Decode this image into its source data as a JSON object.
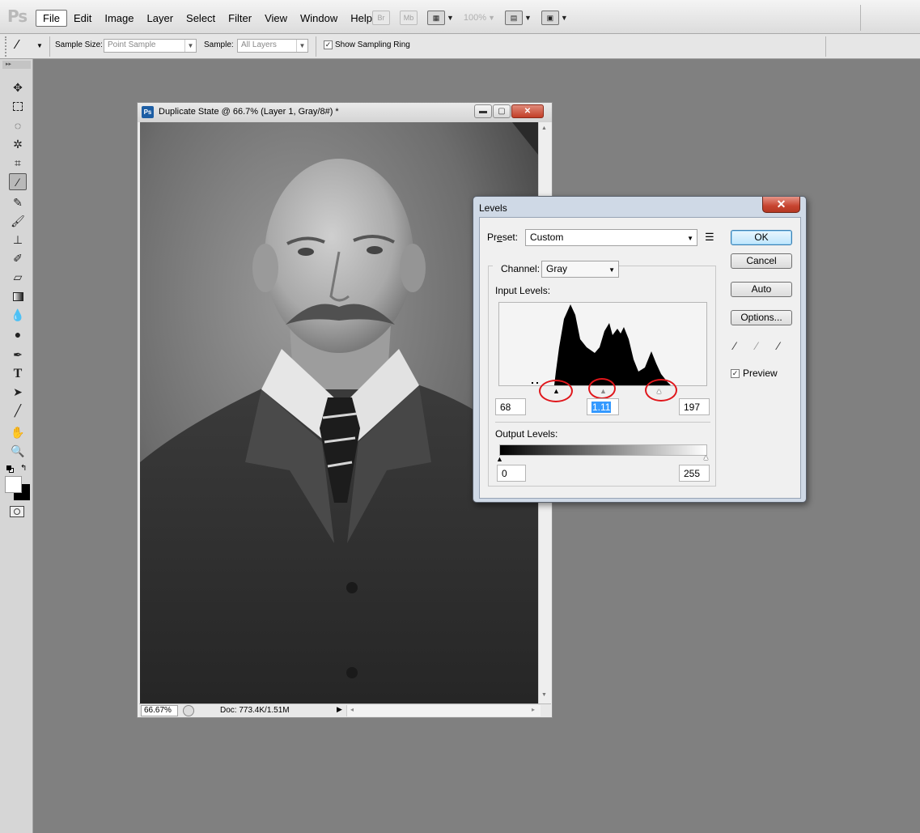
{
  "app": {
    "logo": "Ps",
    "menu": [
      "File",
      "Edit",
      "Image",
      "Layer",
      "Select",
      "Filter",
      "View",
      "Window",
      "Help"
    ],
    "menubar_icons": {
      "bridge": "Br",
      "mini_bridge": "Mb",
      "zoom": "100%"
    }
  },
  "options_bar": {
    "sample_size_label": "Sample Size:",
    "sample_size_value": "Point Sample",
    "sample_label": "Sample:",
    "sample_value": "All Layers",
    "show_ring_label": "Show Sampling Ring",
    "show_ring_checked": true
  },
  "toolbox": {
    "header": "▸▸",
    "tools": [
      "move-icon",
      "marquee-icon",
      "lasso-icon",
      "quick-select-icon",
      "crop-icon",
      "eyedropper-icon",
      "healing-brush-icon",
      "brush-icon",
      "clone-stamp-icon",
      "history-brush-icon",
      "eraser-icon",
      "gradient-icon",
      "blur-icon",
      "dodge-icon",
      "pen-icon",
      "type-icon",
      "path-select-icon",
      "line-icon",
      "hand-icon",
      "zoom-icon"
    ],
    "selected_tool": "eyedropper-icon"
  },
  "document": {
    "ps_icon": "Ps",
    "title": "Duplicate State @ 66.7% (Layer 1, Gray/8#) *",
    "zoom": "66.67%",
    "doc_info": "Doc: 773.4K/1.51M"
  },
  "levels": {
    "title": "Levels",
    "preset_label_pre": "Pr",
    "preset_label_mn": "e",
    "preset_label_post": "set:",
    "preset_value": "Custom",
    "channel_label": "Channel:",
    "channel_value": "Gray",
    "input_levels_label": "Input Levels:",
    "input_black": "68",
    "input_gamma": "1.11",
    "input_white": "197",
    "output_levels_label": "Output Levels:",
    "output_black": "0",
    "output_white": "255",
    "buttons": {
      "ok": "OK",
      "cancel": "Cancel",
      "auto": "Auto",
      "options": "Options..."
    },
    "preview_label": "Preview",
    "preview_checked": true
  }
}
